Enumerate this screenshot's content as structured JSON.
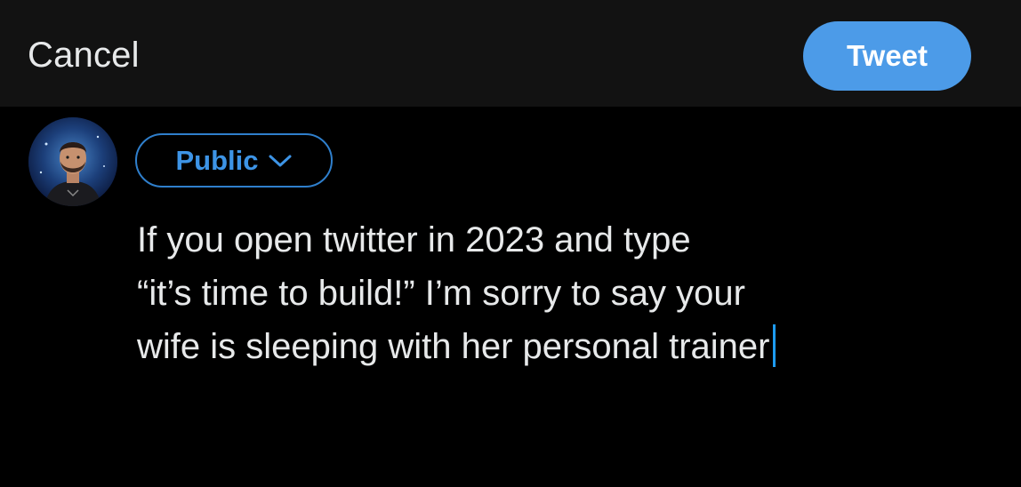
{
  "header": {
    "cancel_label": "Cancel",
    "tweet_label": "Tweet"
  },
  "composer": {
    "audience_label": "Public",
    "lines": [
      "If you open twitter in 2023 and type",
      "“it’s time to build!” I’m sorry to say your",
      "wife is sleeping with her personal trainer"
    ]
  },
  "icons": {
    "avatar": "user-avatar",
    "audience_dropdown": "chevron-down-icon",
    "caret": "text-cursor"
  },
  "colors": {
    "accent": "#4c9be8",
    "audience_text": "#3d94e6",
    "background": "#000000",
    "header_bg": "#121212",
    "text": "#e7e9ea"
  }
}
